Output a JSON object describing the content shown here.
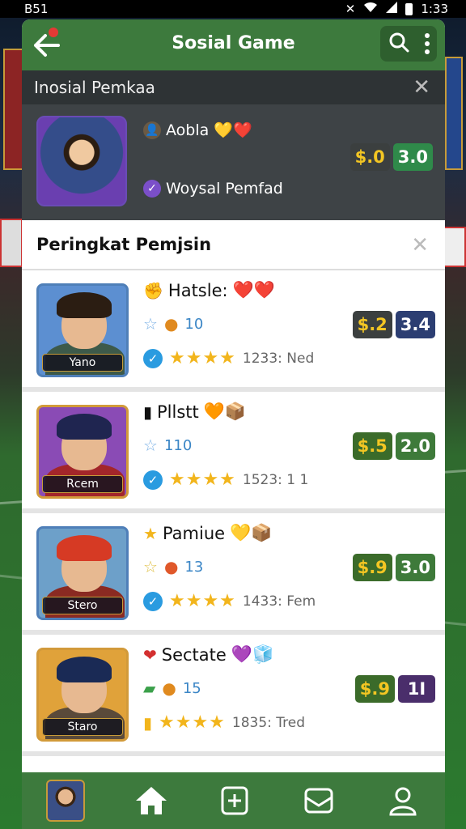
{
  "status_bar": {
    "left": "B51",
    "time": "1:33"
  },
  "header": {
    "title": "Sosial Game"
  },
  "notification": {
    "title": "Inosial Pemkaa",
    "line1": "Aobla",
    "line1_icons": "💛❤️",
    "line2": "Woysal Pemfad",
    "badge_price": "$.0",
    "badge_score": "3.0"
  },
  "ranking": {
    "title": "Peringkat Pemjsin",
    "items": [
      {
        "name": "Hatsle:",
        "name_icons": "❤️❤️",
        "tag": "Yano",
        "level": "10",
        "rating_text": "1233: Ned",
        "price": "$.2",
        "score": "3.4",
        "colors": {
          "frame": "#4f7fb8",
          "hair": "#2b1d12",
          "body": "#3d5a4a",
          "bg": "#5c8fd1"
        }
      },
      {
        "name": "Pllstt",
        "name_icons": "🧡📦",
        "tag": "Rcem",
        "level": "110",
        "rating_text": "1523: 1 1",
        "price": "$.5",
        "score": "2.0",
        "colors": {
          "frame": "#d29a3a",
          "hair": "#1f2550",
          "body": "#a3262a",
          "bg": "#8a4bb5"
        }
      },
      {
        "name": "Pamiue",
        "name_icons": "💛📦",
        "tag": "Stero",
        "level": "13",
        "rating_text": "1433: Fem",
        "price": "$.9",
        "score": "3.0",
        "colors": {
          "frame": "#4f7fb8",
          "hair": "#d63a24",
          "body": "#8a2a22",
          "bg": "#6da0c9"
        }
      },
      {
        "name": "Sectate",
        "name_icons": "💜🧊",
        "tag": "Staro",
        "level": "15",
        "rating_text": "1835: Tred",
        "price": "$.9",
        "score": "1I",
        "colors": {
          "frame": "#d29a3a",
          "hair": "#1a2a55",
          "body": "#5a4a3a",
          "bg": "#e0a23a"
        }
      }
    ]
  }
}
